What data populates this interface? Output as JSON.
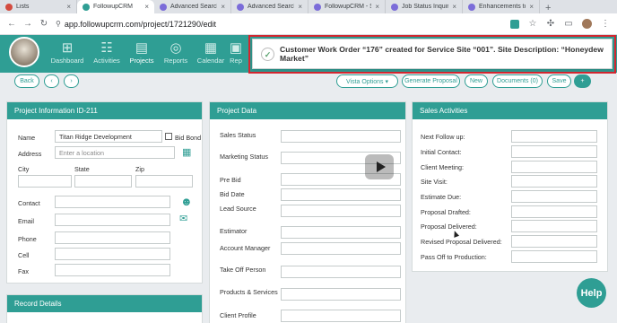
{
  "browser": {
    "tabs": [
      {
        "title": "Lists",
        "color": "#d34b3f"
      },
      {
        "title": "FollowupCRM",
        "color": "#2f9e94"
      },
      {
        "title": "Advanced Search",
        "color": "#7b6cd9"
      },
      {
        "title": "Advanced Search",
        "color": "#7b6cd9"
      },
      {
        "title": "FollowupCRM - S",
        "color": "#7b6cd9"
      },
      {
        "title": "Job Status Inquiry",
        "color": "#7b6cd9"
      },
      {
        "title": "Enhancements to",
        "color": "#7b6cd9"
      }
    ],
    "new_tab": "+",
    "url": "app.followupcrm.com/project/1721290/edit"
  },
  "nav": {
    "items": [
      "Dashboard",
      "Activities",
      "Projects",
      "Reports",
      "Calendar",
      "Rep"
    ]
  },
  "notification": {
    "text": "Customer Work Order “176” created for Service Site “001”. Site Description: “Honeydew Market”"
  },
  "toolbar": {
    "back": "Back",
    "prev": "‹",
    "next": "›",
    "vista_options": "Vista Options ▾",
    "generate_proposal": "Generate Proposal",
    "new": "New",
    "documents": "Documents (0)",
    "save": "Save",
    "plus": "+"
  },
  "project_info": {
    "title": "Project Information ID-211",
    "name_label": "Name",
    "name_value": "Titan Ridge Development",
    "bid_bond": "Bid Bond",
    "address_label": "Address",
    "address_placeholder": "Enter a location",
    "city": "City",
    "state": "State",
    "zip": "Zip",
    "contact": "Contact",
    "email": "Email",
    "phone": "Phone",
    "cell": "Cell",
    "fax": "Fax"
  },
  "record_details": {
    "title": "Record Details"
  },
  "project_data": {
    "title": "Project Data",
    "fields": [
      "Sales Status",
      "Marketing Status",
      "Pre Bid",
      "Bid Date",
      "Lead Source",
      "Estimator",
      "Account Manager",
      "Take Off Person",
      "Products & Services",
      "Client Profile"
    ]
  },
  "sales_activities": {
    "title": "Sales Activities",
    "fields": [
      "Next Follow up:",
      "Initial Contact:",
      "Client Meeting:",
      "Site Visit:",
      "Estimate Due:",
      "Proposal Drafted:",
      "Proposal Delivered:",
      "Revised Proposal Delivered:",
      "Pass Off to Production:"
    ]
  },
  "help": "Help",
  "icons": {
    "map": "map-icon",
    "contact": "contact-card-icon",
    "email": "envelope-icon",
    "play": "play-icon"
  },
  "colors": {
    "brand": "#2f9e94",
    "highlight": "#d3262f"
  }
}
